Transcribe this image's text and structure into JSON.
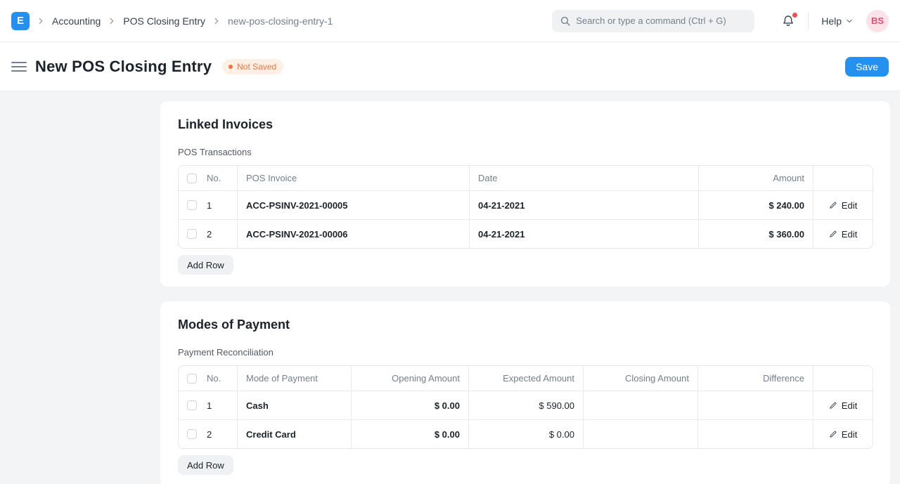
{
  "navbar": {
    "logo_letter": "E",
    "breadcrumbs": [
      "Accounting",
      "POS Closing Entry",
      "new-pos-closing-entry-1"
    ],
    "search_placeholder": "Search or type a command (Ctrl + G)",
    "help_label": "Help",
    "avatar_initials": "BS"
  },
  "page_head": {
    "title": "New POS Closing Entry",
    "status_badge": "Not Saved",
    "save_label": "Save"
  },
  "linked_invoices": {
    "title": "Linked Invoices",
    "section_label": "POS Transactions",
    "headers": {
      "no": "No.",
      "pos_invoice": "POS Invoice",
      "date": "Date",
      "amount": "Amount"
    },
    "rows": [
      {
        "no": "1",
        "pos_invoice": "ACC-PSINV-2021-00005",
        "date": "04-21-2021",
        "amount": "$ 240.00"
      },
      {
        "no": "2",
        "pos_invoice": "ACC-PSINV-2021-00006",
        "date": "04-21-2021",
        "amount": "$ 360.00"
      }
    ],
    "edit_label": "Edit",
    "add_row_label": "Add Row"
  },
  "modes_of_payment": {
    "title": "Modes of Payment",
    "section_label": "Payment Reconciliation",
    "headers": {
      "no": "No.",
      "mode": "Mode of Payment",
      "opening": "Opening Amount",
      "expected": "Expected Amount",
      "closing": "Closing Amount",
      "difference": "Difference"
    },
    "rows": [
      {
        "no": "1",
        "mode": "Cash",
        "opening": "$ 0.00",
        "expected": "$ 590.00",
        "closing": "",
        "difference": ""
      },
      {
        "no": "2",
        "mode": "Credit Card",
        "opening": "$ 0.00",
        "expected": "$ 0.00",
        "closing": "",
        "difference": ""
      }
    ],
    "edit_label": "Edit",
    "add_row_label": "Add Row"
  },
  "colors": {
    "accent_blue": "#2490ef",
    "badge_orange_text": "#f8703e",
    "badge_orange_bg": "#fff0e6",
    "avatar_bg": "#fde3e9",
    "avatar_text": "#e5506f",
    "notification_dot": "#f15050",
    "main_background": "#f3f4f6"
  }
}
